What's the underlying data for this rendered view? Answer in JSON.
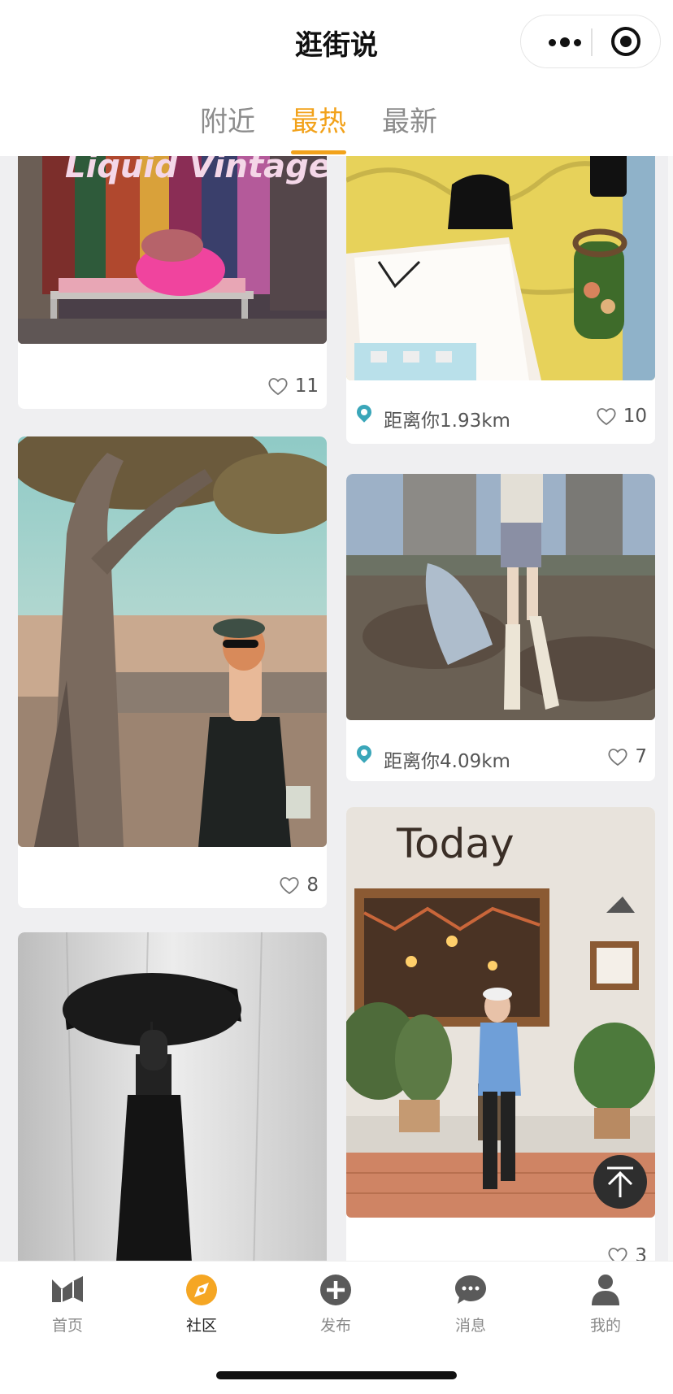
{
  "header": {
    "title": "逛街说"
  },
  "tabs": [
    {
      "label": "附近",
      "active": false
    },
    {
      "label": "最热",
      "active": true
    },
    {
      "label": "最新",
      "active": false
    }
  ],
  "accent_color": "#f2a21b",
  "location_color": "#3aa6b9",
  "feed": {
    "left_column": [
      {
        "photo": "vintage-shop-liquid-vintage",
        "photo_text": "Liquid Vintage",
        "distance": "",
        "likes": "11"
      },
      {
        "photo": "woman-by-tree-black-dress",
        "distance": "",
        "likes": "8"
      },
      {
        "photo": "woman-with-black-umbrella",
        "distance": "",
        "likes": ""
      }
    ],
    "right_column": [
      {
        "photo": "handbags-on-yellow-wallpaper",
        "distance": "距离你1.93km",
        "likes": "10"
      },
      {
        "photo": "woman-in-white-boots",
        "distance": "距离你4.09km",
        "likes": "7"
      },
      {
        "photo": "cafe-today-storefront",
        "photo_text": "Today",
        "distance": "",
        "likes": "3"
      }
    ]
  },
  "tabbar": [
    {
      "label": "首页",
      "icon": "home-icon",
      "active": false
    },
    {
      "label": "社区",
      "icon": "compass-icon",
      "active": true
    },
    {
      "label": "发布",
      "icon": "plus-circle-icon",
      "active": false
    },
    {
      "label": "消息",
      "icon": "chat-bubble-icon",
      "active": false
    },
    {
      "label": "我的",
      "icon": "person-icon",
      "active": false
    }
  ]
}
